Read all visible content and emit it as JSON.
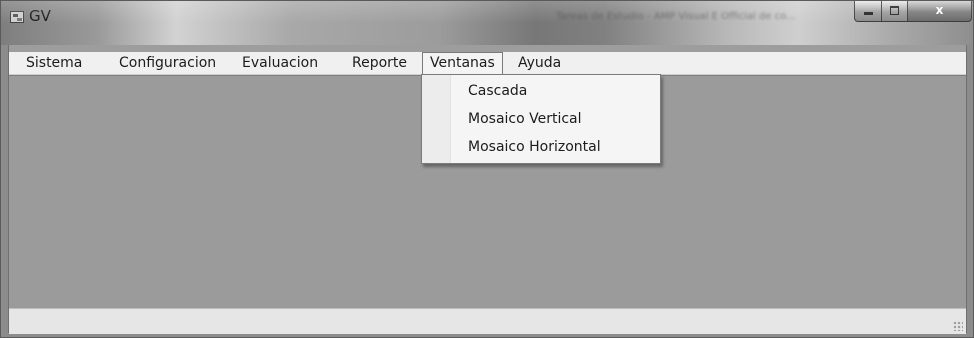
{
  "window": {
    "title": "GV",
    "title_blurred": "Tareas de Estudio - AMP Visual E Official de co...",
    "controls": {
      "minimize": "minimize-icon",
      "maximize": "maximize-icon",
      "close": "x"
    }
  },
  "menubar": {
    "items": [
      {
        "label": "Sistema"
      },
      {
        "label": "Configuracion"
      },
      {
        "label": "Evaluacion"
      },
      {
        "label": "Reporte"
      },
      {
        "label": "Ventanas"
      },
      {
        "label": "Ayuda"
      }
    ],
    "open_menu": "Ventanas"
  },
  "dropdown": {
    "items": [
      {
        "label": "Cascada"
      },
      {
        "label": "Mosaico Vertical"
      },
      {
        "label": "Mosaico Horizontal"
      }
    ]
  },
  "colors": {
    "client_background": "#9b9b9b",
    "menubar_background": "#f0f0f0",
    "statusbar_background": "#e6e6e6"
  }
}
